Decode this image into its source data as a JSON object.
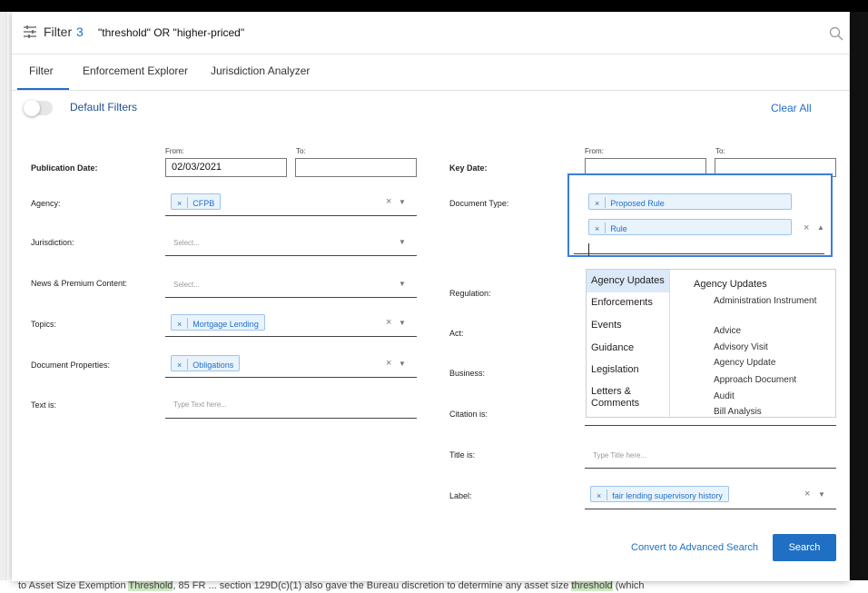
{
  "search": {
    "filter_label": "Filter",
    "filter_count": "3",
    "query": "\"threshold\" OR \"higher-priced\""
  },
  "tabs": [
    "Filter",
    "Enforcement Explorer",
    "Jurisdiction Analyzer"
  ],
  "header": {
    "default_filters": "Default Filters",
    "clear_all": "Clear All"
  },
  "range_labels": {
    "from": "From:",
    "to": "To:"
  },
  "left": {
    "publication_date": {
      "label": "Publication Date:",
      "from": "02/03/2021",
      "to": ""
    },
    "agency": {
      "label": "Agency:",
      "chip": "CFPB"
    },
    "jurisdiction": {
      "label": "Jurisdiction:",
      "placeholder": "Select..."
    },
    "news": {
      "label": "News & Premium Content:",
      "placeholder": "Select..."
    },
    "topics": {
      "label": "Topics:",
      "chip": "Mortgage Lending"
    },
    "document_properties": {
      "label": "Document Properties:",
      "chip": "Obligations"
    },
    "text_is": {
      "label": "Text is:",
      "placeholder": "Type Text here..."
    }
  },
  "right": {
    "key_date": {
      "label": "Key Date:",
      "from": "",
      "to": ""
    },
    "document_type": {
      "label": "Document Type:",
      "chips": [
        "Proposed Rule",
        "Rule"
      ]
    },
    "regulation": {
      "label": "Regulation:"
    },
    "act": {
      "label": "Act:"
    },
    "business": {
      "label": "Business:"
    },
    "citation": {
      "label": "Citation is:"
    },
    "title_is": {
      "label": "Title is:",
      "placeholder": "Type Title here..."
    },
    "label_field": {
      "label": "Label:",
      "chip": "fair lending supervisory history"
    }
  },
  "dropdown": {
    "categories": [
      "Agency Updates",
      "Enforcements",
      "Events",
      "Guidance",
      "Legislation",
      "Letters &\nComments"
    ],
    "active_category": "Agency Updates",
    "heading": "Agency Updates",
    "items": [
      "Administration Instrument",
      "Advice",
      "Advisory Visit",
      "Agency Update",
      "Approach Document",
      "Audit",
      "Bill Analysis"
    ]
  },
  "footer": {
    "convert": "Convert to Advanced Search",
    "search": "Search"
  },
  "background": {
    "bottom_text_a": "to Asset Size Exemption ",
    "bottom_hl1": "Threshold",
    "bottom_text_b": ", 85 FR ... section 129D(c)(1) also gave the Bureau discretion to determine any asset size ",
    "bottom_hl2": "threshold",
    "bottom_text_c": " (which"
  },
  "colors": {
    "accent": "#1f6fc5",
    "chip_bg": "#e9f3fc",
    "focus": "#3b7ddd"
  }
}
